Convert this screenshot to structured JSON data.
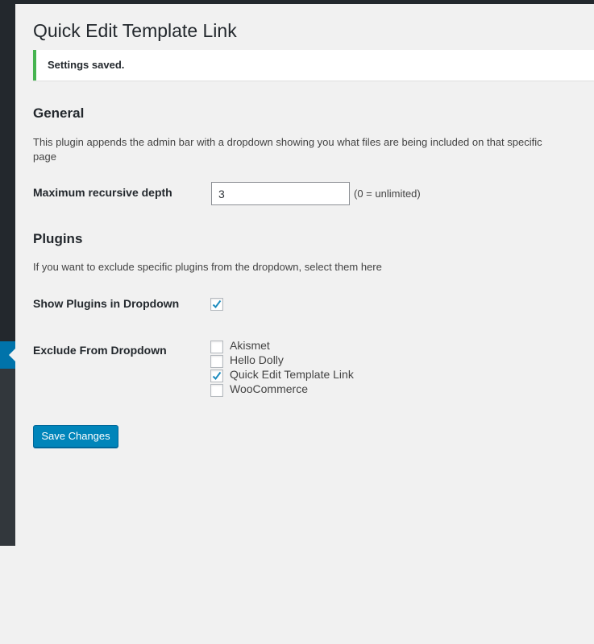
{
  "page": {
    "title": "Quick Edit Template Link"
  },
  "notice": {
    "text": "Settings saved.",
    "color": "#46b450"
  },
  "general": {
    "heading": "General",
    "description": "This plugin appends the admin bar with a dropdown showing you what files are being included on that specific page",
    "depth_label": "Maximum recursive depth",
    "depth_value": "3",
    "depth_hint": "(0 = unlimited)"
  },
  "plugins": {
    "heading": "Plugins",
    "description": "If you want to exclude specific plugins from the dropdown, select them here",
    "show_label": "Show Plugins in Dropdown",
    "show_checked": true,
    "exclude_label": "Exclude From Dropdown",
    "exclude_options": [
      {
        "label": "Akismet",
        "checked": false
      },
      {
        "label": "Hello Dolly",
        "checked": false
      },
      {
        "label": "Quick Edit Template Link",
        "checked": true
      },
      {
        "label": "WooCommerce",
        "checked": false
      }
    ]
  },
  "actions": {
    "save_label": "Save Changes",
    "save_color": "#0085ba"
  },
  "icons": {
    "checkmark": "check-icon",
    "active_menu": "menu-current-arrow-icon"
  }
}
